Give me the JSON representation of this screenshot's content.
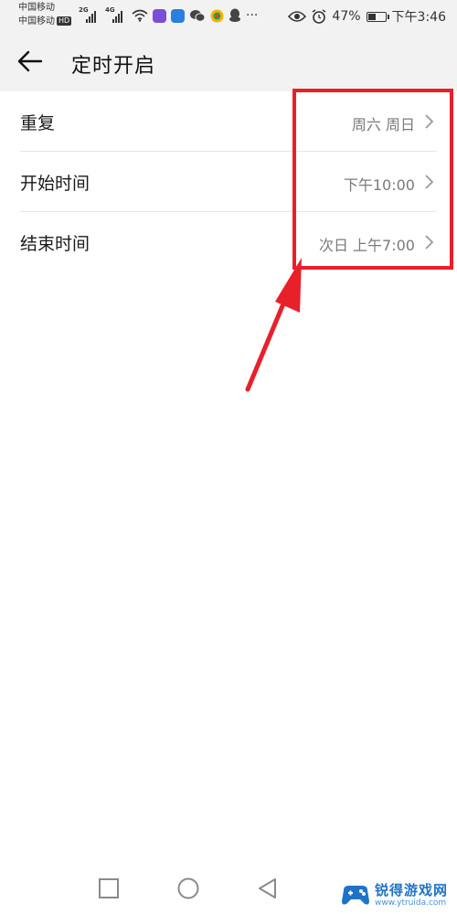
{
  "status_bar": {
    "carrier_1": "中国移动",
    "carrier_2": "中国移动",
    "hd_badge": "HD",
    "network_1": "2G",
    "network_2": "4G",
    "more_dots": "···",
    "battery_percent": "47%",
    "battery_level": 0.47,
    "time": "下午3:46",
    "icons": [
      "signal-icon",
      "signal-icon",
      "wifi-icon",
      "video-app-icon",
      "shield-app-icon",
      "wechat-icon",
      "camera-app-icon",
      "qq-icon",
      "eye-icon",
      "alarm-icon",
      "battery-icon"
    ]
  },
  "header": {
    "back_icon": "back-arrow-icon",
    "title": "定时开启"
  },
  "settings": {
    "rows": [
      {
        "label": "重复",
        "value": "周六 周日"
      },
      {
        "label": "开始时间",
        "value": "下午10:00"
      },
      {
        "label": "结束时间",
        "value": "次日 上午7:00"
      }
    ]
  },
  "annotation": {
    "color": "#e8202a",
    "shapes": [
      "highlight-box",
      "pointer-arrow"
    ]
  },
  "nav_bar": {
    "buttons": [
      "recent-apps-icon",
      "home-icon",
      "back-icon"
    ]
  },
  "watermark": {
    "name": "锐得游戏网",
    "url": "www.ytruida.com"
  },
  "colors": {
    "top_background": "#f2f2f2",
    "value_text": "#7a7a7a",
    "watermark_blue": "#1e73c8"
  }
}
